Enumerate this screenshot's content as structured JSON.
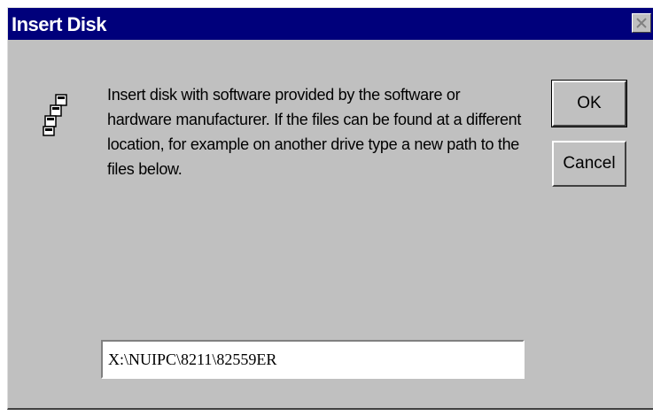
{
  "window": {
    "title": "Insert Disk",
    "close_icon": "close-icon",
    "title_bar_color": "#00007b",
    "background_color": "#c0c0c0"
  },
  "dialog": {
    "icon": "disk-icon",
    "message": "Insert disk with software provided by the software or hardware manufacturer. If the files can be found at a different location, for example on another drive type a new path to the files below.",
    "path_value": "X:\\NUIPC\\8211\\82559ER"
  },
  "buttons": {
    "ok_label": "OK",
    "cancel_label": "Cancel"
  }
}
